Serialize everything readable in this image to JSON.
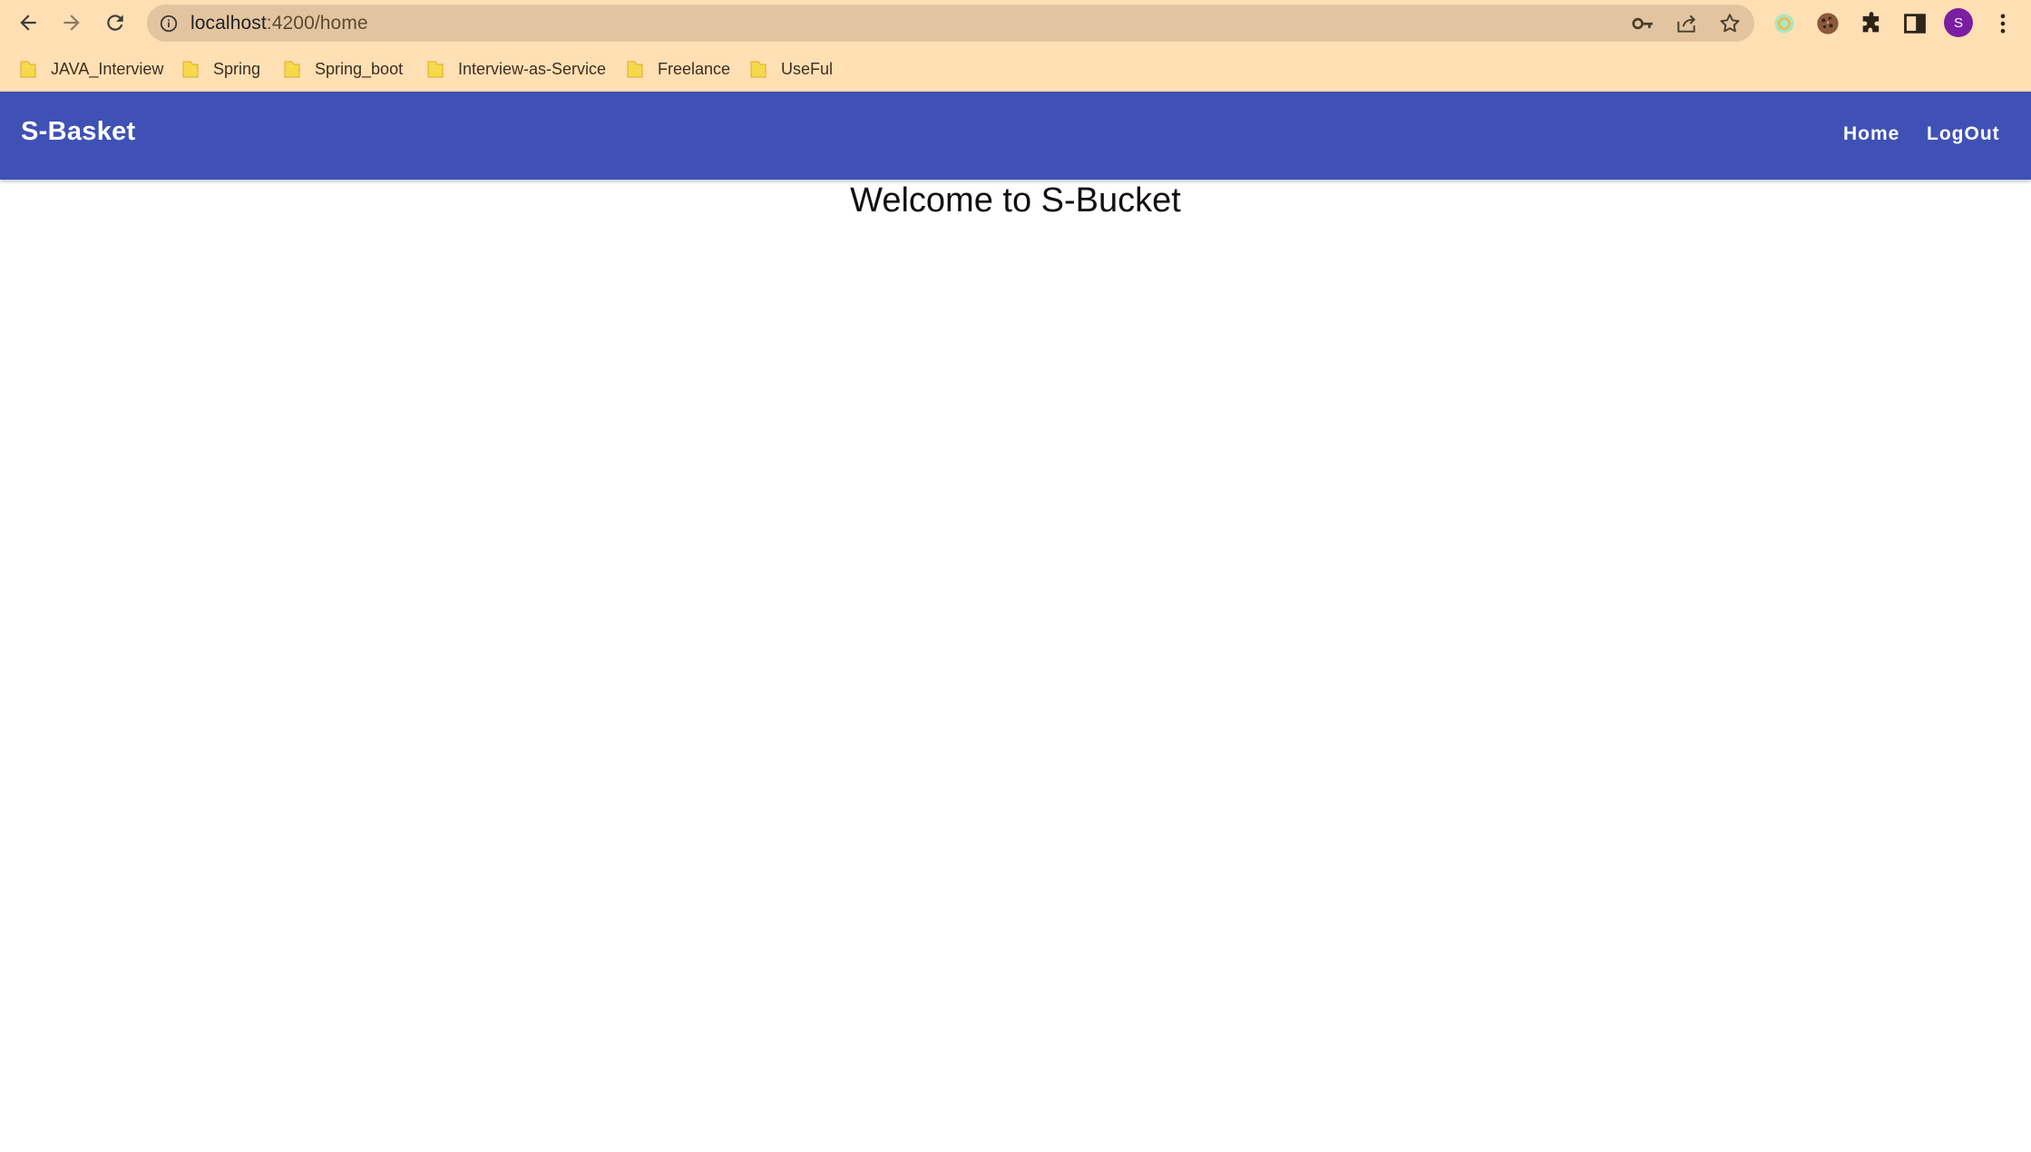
{
  "browser": {
    "url_host": "localhost",
    "url_rest": ":4200/home",
    "profile_initial": "S"
  },
  "bookmarks": [
    {
      "label": "JAVA_Interview"
    },
    {
      "label": "Spring"
    },
    {
      "label": "Spring_boot"
    },
    {
      "label": "Interview-as-Service"
    },
    {
      "label": "Freelance"
    },
    {
      "label": "UseFul"
    }
  ],
  "app": {
    "brand": "S-Basket",
    "nav": {
      "home": "Home",
      "logout": "LogOut"
    },
    "welcome": "Welcome to S-Bucket"
  },
  "colors": {
    "chrome_bg": "#ffdfb4",
    "app_bar": "#3f51b5",
    "avatar": "#7b1fa2"
  },
  "icons": [
    "back-arrow-icon",
    "forward-arrow-icon",
    "reload-icon",
    "info-icon",
    "key-icon",
    "share-icon",
    "star-icon",
    "extension-icon",
    "cookie-icon",
    "puzzle-icon",
    "side-panel-icon",
    "kebab-menu-icon",
    "folder-icon"
  ]
}
